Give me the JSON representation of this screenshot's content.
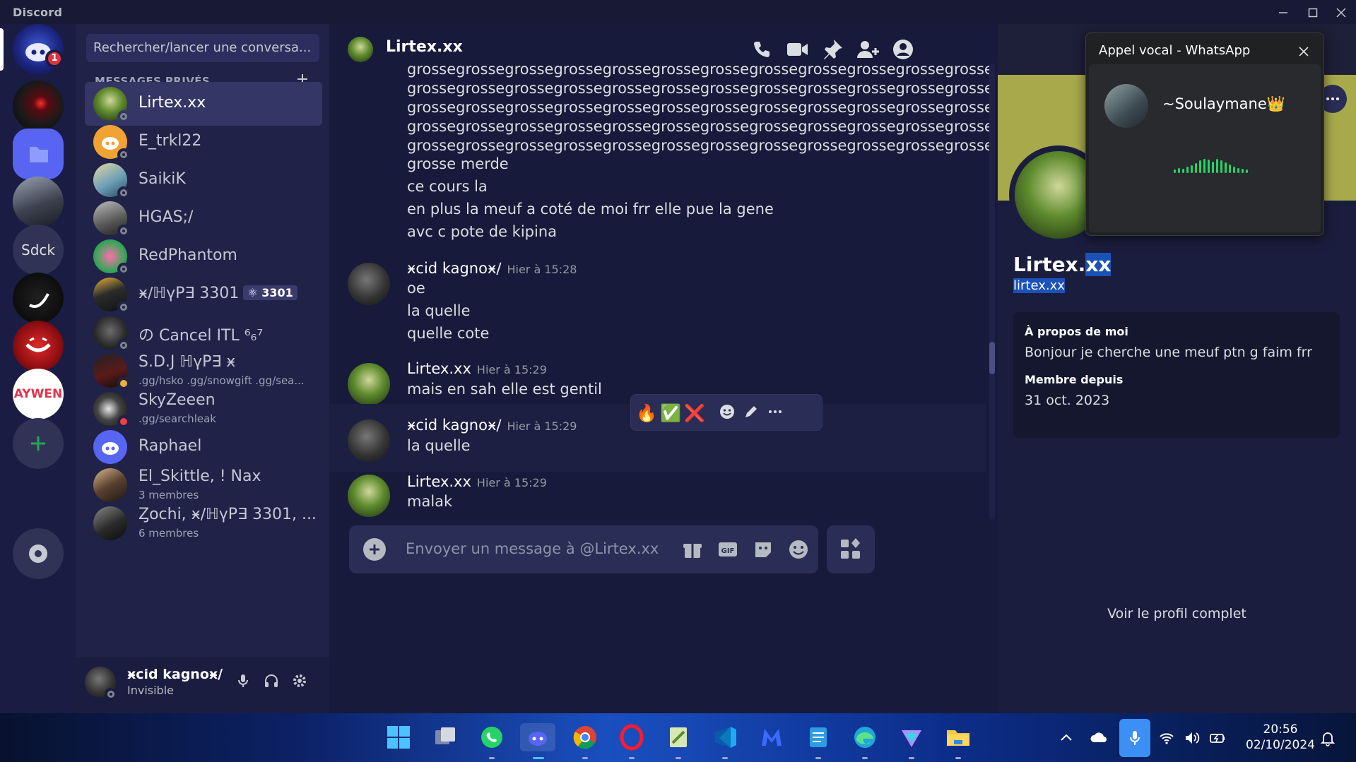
{
  "window": {
    "app_name": "Discord"
  },
  "servers": [
    {
      "name": "home",
      "badge": "1"
    },
    {
      "name": "server-red-eye"
    },
    {
      "name": "folder"
    },
    {
      "name": "server-group-photo"
    },
    {
      "name": "server-sdck",
      "label": "Sdck"
    },
    {
      "name": "server-smile-dark"
    },
    {
      "name": "server-red-smile"
    },
    {
      "name": "server-aywen",
      "label": "AYWEN"
    }
  ],
  "dm": {
    "search_placeholder": "Rechercher/lancer une conversa...",
    "header": "MESSAGES PRIVÉS",
    "items": [
      {
        "name": "Lirtex.xx"
      },
      {
        "name": "E_trkl22"
      },
      {
        "name": "SaikiK"
      },
      {
        "name": "HGAS;/"
      },
      {
        "name": "RedPhantom"
      },
      {
        "name": "ӿ∕ℍүΡ∃ 3301",
        "tag": "⚛ 3301"
      },
      {
        "name": "の Cancel ITL ⁶₆⁷"
      },
      {
        "name": "S.D.J ℍүΡ∃ ӿ",
        "sub": ".gg/hsko .gg/snowgift .gg/sea..."
      },
      {
        "name": "SkyZeeen",
        "sub": ".gg/searchleak"
      },
      {
        "name": "Raphael"
      },
      {
        "name": "El_Skittle, ! Nax",
        "sub": "3 membres"
      },
      {
        "name": "Ȥochi, ӿ∕ℍүΡ∃ 3301, ...",
        "sub": "6 membres"
      }
    ]
  },
  "user": {
    "name": "ӿcid kagnoӿ∕",
    "status": "Invisible"
  },
  "chat": {
    "recipient": "Lirtex.xx",
    "spam_line": "grossegrossegrossegrossegrossegrossegrossegrossegrossegrossegrossegrosse",
    "lines_a": [
      "grosse merde",
      "ce cours la",
      "en plus la meuf a coté de moi frr elle pue la gene",
      "avc c pote de kipina"
    ],
    "messages": [
      {
        "author": "ӿcid kagnoӿ∕",
        "time": "Hier à 15:28",
        "lines": [
          "oe",
          "la quelle",
          "quelle cote"
        ]
      },
      {
        "author": "Lirtex.xx",
        "time": "Hier à 15:29",
        "lines": [
          "mais en sah elle est gentil"
        ]
      },
      {
        "author": "ӿcid kagnoӿ∕",
        "time": "Hier à 15:29",
        "lines": [
          "la quelle"
        ]
      },
      {
        "author": "Lirtex.xx",
        "time": "Hier à 15:29",
        "lines": [
          "malak"
        ]
      }
    ],
    "reactions": [
      "🔥",
      "✅",
      "❌"
    ],
    "composer_placeholder": "Envoyer un message à @Lirtex.xx"
  },
  "profile": {
    "display_name_a": "Lirtex.",
    "display_name_b": "xx",
    "username": "lirtex.xx",
    "about_title": "À propos de moi",
    "about_text": "Bonjour je cherche une meuf ptn g faim frr",
    "since_title": "Membre depuis",
    "since_value": "31 oct. 2023",
    "full_profile": "Voir le profil complet",
    "banner_color": "#a7a94b"
  },
  "whatsapp": {
    "title": "Appel vocal - WhatsApp",
    "caller": "~Soulaymane👑",
    "wave_levels": [
      0.25,
      0.35,
      0.3,
      0.45,
      0.55,
      0.7,
      0.9,
      1,
      0.95,
      0.8,
      1,
      0.9,
      0.75,
      0.6,
      0.45,
      0.35,
      0.3,
      0.25
    ]
  },
  "taskbar": {
    "time": "20:56",
    "date": "02/10/2024"
  }
}
